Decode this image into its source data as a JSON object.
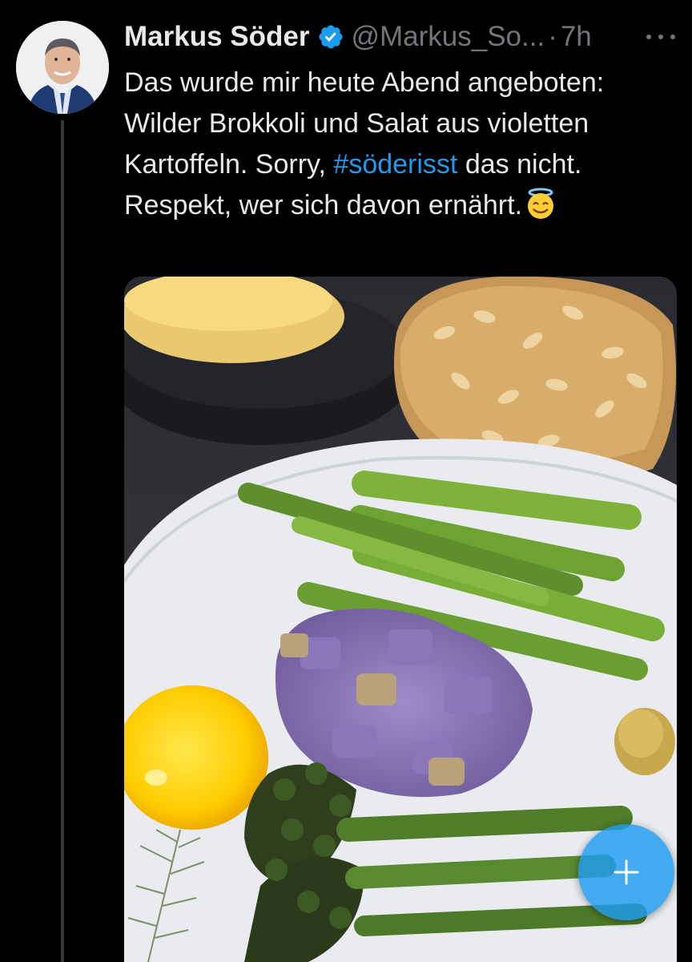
{
  "tweet": {
    "author": {
      "display_name": "Markus Söder",
      "handle": "@Markus_So...",
      "verified_icon": "verified-badge-icon",
      "avatar_icon": "profile-avatar"
    },
    "separator": "·",
    "timestamp": "7h",
    "more_icon": "more-options-icon",
    "text": {
      "part1": "Das wurde mir heute Abend angeboten: Wilder Brokkoli und Salat aus violetten Kartoffeln. Sorry, ",
      "hashtag": "#söderisst",
      "part2": " das nicht. Respekt, wer sich davon ernährt.",
      "emoji": "smiling-face-with-halo"
    },
    "media": {
      "kind": "photo",
      "subject": "plate-with-asparagus-purple-potato-broccolini-egg-yolk-bread-roll"
    }
  },
  "compose_button": {
    "icon": "plus-icon"
  },
  "colors": {
    "background": "#000000",
    "text_primary": "#e7e9ea",
    "text_secondary": "#71767b",
    "accent": "#1d9bf0",
    "thread_line": "#333639"
  }
}
